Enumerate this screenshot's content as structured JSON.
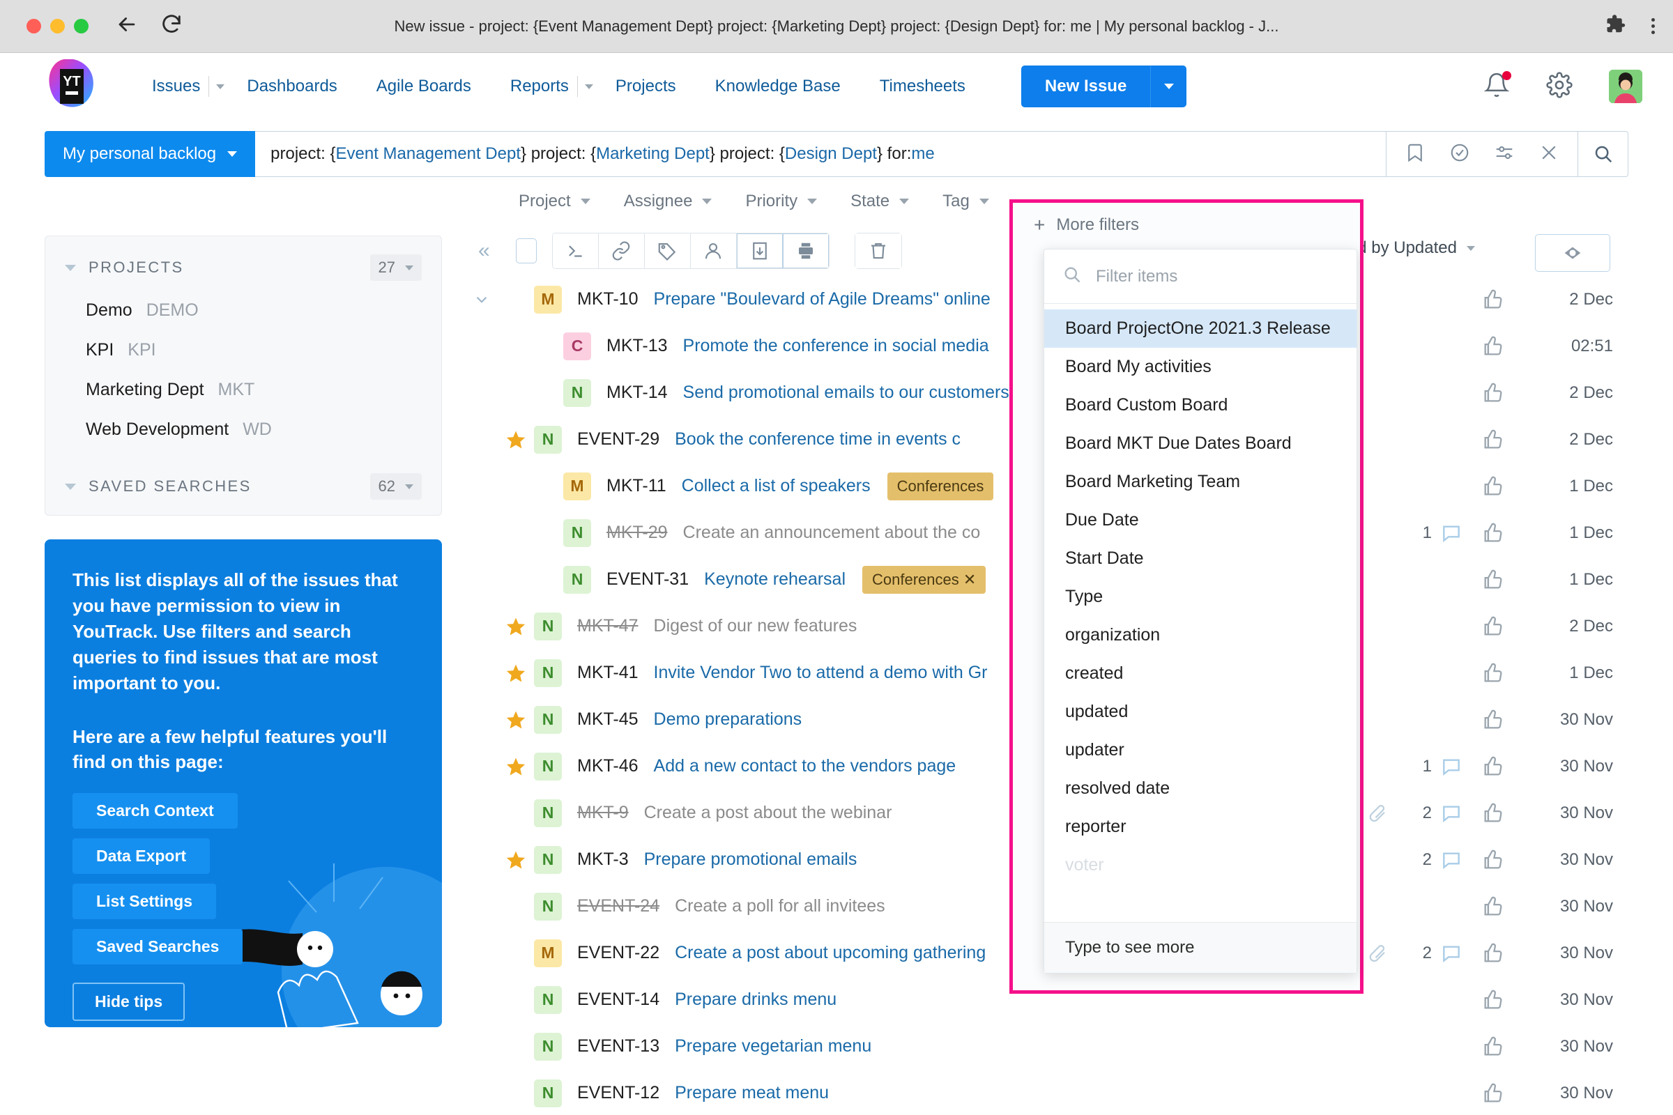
{
  "browser": {
    "tab_title": "New issue - project: {Event Management Dept} project: {Marketing Dept} project: {Design Dept} for: me | My personal backlog - J...",
    "back_icon": "back-arrow-icon",
    "reload_icon": "reload-icon",
    "extensions_icon": "puzzle-icon",
    "menu_icon": "kebab-menu-icon"
  },
  "header": {
    "logo_text": "YT",
    "nav": [
      {
        "label": "Issues",
        "has_caret": true
      },
      {
        "label": "Dashboards",
        "has_caret": false
      },
      {
        "label": "Agile Boards",
        "has_caret": false
      },
      {
        "label": "Reports",
        "has_caret": true
      },
      {
        "label": "Projects",
        "has_caret": false
      },
      {
        "label": "Knowledge Base",
        "has_caret": false
      },
      {
        "label": "Timesheets",
        "has_caret": false
      }
    ],
    "new_issue_label": "New Issue",
    "accent_blue": "#0d7eeb",
    "notification_badge_color": "#e8003c"
  },
  "query_bar": {
    "saved_search_label": "My personal backlog",
    "query_parts": [
      {
        "text": "project: {",
        "link": false
      },
      {
        "text": "Event Management Dept",
        "link": true
      },
      {
        "text": "} project: {",
        "link": false
      },
      {
        "text": "Marketing Dept",
        "link": true
      },
      {
        "text": "} project: {",
        "link": false
      },
      {
        "text": "Design Dept",
        "link": true
      },
      {
        "text": "} for: ",
        "link": false
      },
      {
        "text": "me",
        "link": true
      }
    ],
    "action_icons": [
      "bookmark-icon",
      "check-circle-icon",
      "sliders-icon",
      "close-icon"
    ],
    "search_icon": "search-icon"
  },
  "filters": [
    {
      "label": "Project"
    },
    {
      "label": "Assignee"
    },
    {
      "label": "Priority"
    },
    {
      "label": "State"
    },
    {
      "label": "Tag"
    }
  ],
  "more_filters": {
    "title": "More filters",
    "search_placeholder": "Filter items",
    "search_value": "",
    "items": [
      {
        "label": "Board ProjectOne 2021.3 Release",
        "selected": true
      },
      {
        "label": "Board My activities",
        "selected": false
      },
      {
        "label": "Board Custom Board",
        "selected": false
      },
      {
        "label": "Board MKT Due Dates Board",
        "selected": false
      },
      {
        "label": "Board Marketing Team",
        "selected": false
      },
      {
        "label": "Due Date",
        "selected": false
      },
      {
        "label": "Start Date",
        "selected": false
      },
      {
        "label": "Type",
        "selected": false
      },
      {
        "label": "organization",
        "selected": false
      },
      {
        "label": "created",
        "selected": false
      },
      {
        "label": "updated",
        "selected": false
      },
      {
        "label": "updater",
        "selected": false
      },
      {
        "label": "resolved date",
        "selected": false
      },
      {
        "label": "reporter",
        "selected": false
      },
      {
        "label": "voter",
        "selected": false,
        "fading": true
      }
    ],
    "footer": "Type to see more",
    "highlight_color": "#f5108a"
  },
  "sidebar": {
    "projects_section": {
      "title": "PROJECTS",
      "count": "27",
      "items": [
        {
          "name": "Demo",
          "key": "DEMO"
        },
        {
          "name": "KPI",
          "key": "KPI"
        },
        {
          "name": "Marketing Dept",
          "key": "MKT"
        },
        {
          "name": "Web Development",
          "key": "WD"
        }
      ]
    },
    "saved_searches_section": {
      "title": "SAVED SEARCHES",
      "count": "62"
    },
    "tips": {
      "paragraph1": "This list displays all of the issues that you have permission to view in YouTrack. Use filters and search queries to find issues that are most important to you.",
      "paragraph2": "Here are a few helpful features you'll find on this page:",
      "buttons": [
        "Search Context",
        "Data Export",
        "List Settings",
        "Saved Searches"
      ],
      "hide_label": "Hide tips",
      "bg_color": "#0b7fe0"
    }
  },
  "toolbar": {
    "collapse_icon": "collapse-left-icon",
    "select_all_icon": "checkbox-icon",
    "buttons": [
      {
        "icon": "command-prompt-icon",
        "highlighted": false
      },
      {
        "icon": "link-icon",
        "highlighted": false
      },
      {
        "icon": "tag-icon",
        "highlighted": false
      },
      {
        "icon": "user-icon",
        "highlighted": false
      },
      {
        "icon": "export-download-icon",
        "highlighted": true
      },
      {
        "icon": "print-icon",
        "highlighted": true
      }
    ],
    "delete_icon": "trash-icon",
    "sorted_by_label": "Sorted by Updated",
    "eye_icon": "eye-icon"
  },
  "issues": [
    {
      "star": false,
      "chevron": true,
      "prio": "M",
      "id": "MKT-10",
      "summary": "Prepare \"Boulevard of Agile Dreams\" online",
      "resolved": false,
      "tag": null,
      "attach": false,
      "comments": null,
      "date": "2 Dec"
    },
    {
      "star": false,
      "chevron": false,
      "prio": "C",
      "id": "MKT-13",
      "summary": "Promote the conference in social media",
      "resolved": false,
      "tag": null,
      "attach": false,
      "comments": null,
      "date": "02:51",
      "indent": true
    },
    {
      "star": false,
      "chevron": false,
      "prio": "N",
      "id": "MKT-14",
      "summary": "Send promotional emails to our customers",
      "resolved": false,
      "tag": null,
      "attach": false,
      "comments": null,
      "date": "2 Dec",
      "indent": true
    },
    {
      "star": true,
      "chevron": false,
      "prio": "N",
      "id": "EVENT-29",
      "summary": "Book the conference time in events c",
      "resolved": false,
      "tag": null,
      "attach": false,
      "comments": null,
      "date": "2 Dec"
    },
    {
      "star": false,
      "chevron": false,
      "prio": "M",
      "id": "MKT-11",
      "summary": "Collect a list of speakers",
      "resolved": false,
      "tag": "Conferences",
      "attach": false,
      "comments": null,
      "date": "1 Dec",
      "indent": true
    },
    {
      "star": false,
      "chevron": false,
      "prio": "N",
      "id": "MKT-29",
      "summary": "Create an announcement about the co",
      "resolved": true,
      "tag": null,
      "attach": false,
      "comments": "1",
      "date": "1 Dec",
      "indent": true
    },
    {
      "star": false,
      "chevron": false,
      "prio": "N",
      "id": "EVENT-31",
      "summary": "Keynote rehearsal",
      "resolved": false,
      "tag": "Conferences ✕",
      "attach": false,
      "comments": null,
      "date": "1 Dec",
      "indent": true
    },
    {
      "star": true,
      "chevron": false,
      "prio": "N",
      "id": "MKT-47",
      "summary": "Digest of our new features",
      "resolved": true,
      "tag": null,
      "attach": false,
      "comments": null,
      "date": "2 Dec"
    },
    {
      "star": true,
      "chevron": false,
      "prio": "N",
      "id": "MKT-41",
      "summary": "Invite Vendor Two to attend a demo with Gr",
      "resolved": false,
      "tag": null,
      "attach": false,
      "comments": null,
      "date": "1 Dec"
    },
    {
      "star": true,
      "chevron": false,
      "prio": "N",
      "id": "MKT-45",
      "summary": "Demo preparations",
      "resolved": false,
      "tag": null,
      "attach": false,
      "comments": null,
      "date": "30 Nov"
    },
    {
      "star": true,
      "chevron": false,
      "prio": "N",
      "id": "MKT-46",
      "summary": "Add a new contact to the vendors page",
      "resolved": false,
      "tag": null,
      "attach": false,
      "comments": "1",
      "date": "30 Nov"
    },
    {
      "star": false,
      "chevron": false,
      "prio": "N",
      "id": "MKT-9",
      "summary": "Create a post about the webinar",
      "resolved": true,
      "tag": null,
      "attach": true,
      "comments": "2",
      "date": "30 Nov"
    },
    {
      "star": true,
      "chevron": false,
      "prio": "N",
      "id": "MKT-3",
      "summary": "Prepare promotional emails",
      "resolved": false,
      "tag": null,
      "attach": false,
      "comments": "2",
      "date": "30 Nov"
    },
    {
      "star": false,
      "chevron": false,
      "prio": "N",
      "id": "EVENT-24",
      "summary": "Create a poll for all invitees",
      "resolved": true,
      "tag": null,
      "attach": false,
      "comments": null,
      "date": "30 Nov"
    },
    {
      "star": false,
      "chevron": false,
      "prio": "M",
      "id": "EVENT-22",
      "summary": "Create a post about upcoming gathering",
      "resolved": false,
      "tag": null,
      "attach": true,
      "comments": "2",
      "date": "30 Nov"
    },
    {
      "star": false,
      "chevron": false,
      "prio": "N",
      "id": "EVENT-14",
      "summary": "Prepare drinks menu",
      "resolved": false,
      "tag": null,
      "attach": false,
      "comments": null,
      "date": "30 Nov"
    },
    {
      "star": false,
      "chevron": false,
      "prio": "N",
      "id": "EVENT-13",
      "summary": "Prepare vegetarian menu",
      "resolved": false,
      "tag": null,
      "attach": false,
      "comments": null,
      "date": "30 Nov"
    },
    {
      "star": false,
      "chevron": false,
      "prio": "N",
      "id": "EVENT-12",
      "summary": "Prepare meat menu",
      "resolved": false,
      "tag": null,
      "attach": false,
      "comments": null,
      "date": "30 Nov"
    }
  ]
}
